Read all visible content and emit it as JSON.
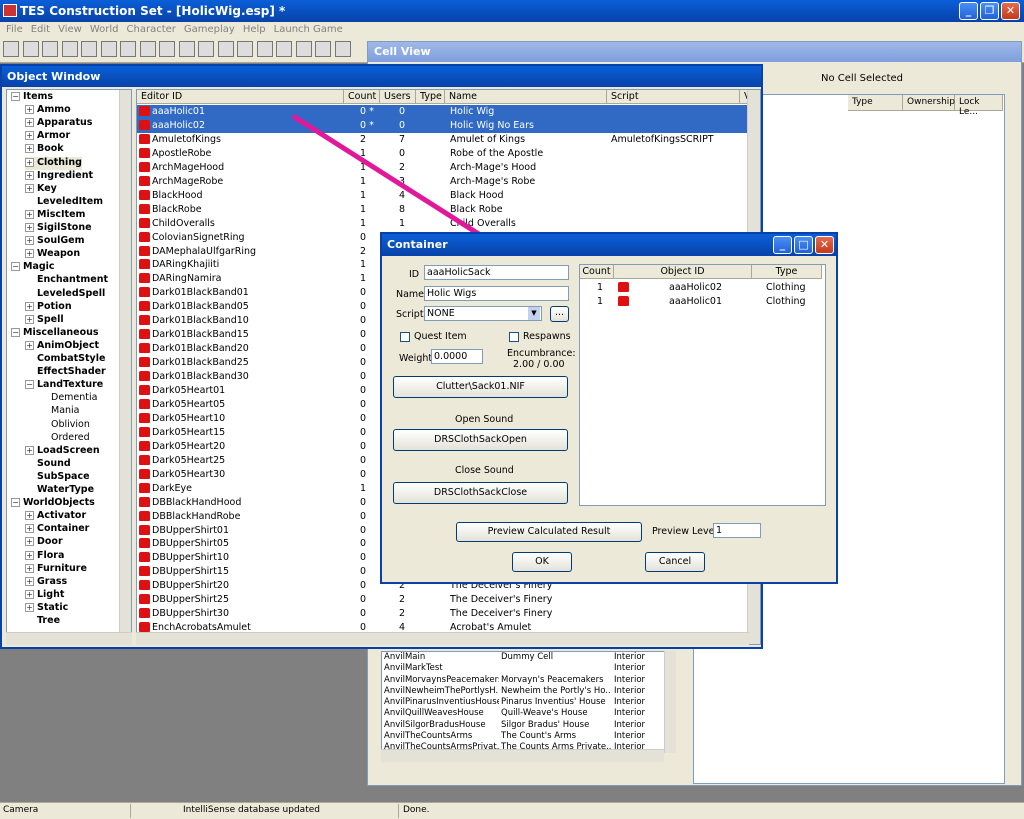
{
  "app": {
    "title": "TES Construction Set - [HolicWig.esp] *"
  },
  "menu": [
    "File",
    "Edit",
    "View",
    "World",
    "Character",
    "Gameplay",
    "Help",
    "Launch Game"
  ],
  "cell_view": {
    "title": "Cell View",
    "no_cell": "No Cell Selected",
    "columns": [
      "Type",
      "Ownership",
      "Lock Le..."
    ],
    "rows": [
      [
        "AnvilMain",
        "Dummy Cell",
        "Interior"
      ],
      [
        "AnvilMarkTest",
        "",
        "Interior"
      ],
      [
        "AnvilMorvaynsPeacemakers",
        "Morvayn's Peacemakers",
        "Interior"
      ],
      [
        "AnvilNewheimThePortlysH...",
        "Newheim the Portly's Ho...",
        "Interior"
      ],
      [
        "AnvilPinarusInventiusHouse",
        "Pinarus Inventius' House",
        "Interior"
      ],
      [
        "AnvilQuillWeavesHouse",
        "Quill-Weave's House",
        "Interior"
      ],
      [
        "AnvilSilgorBradusHouse",
        "Silgor Bradus' House",
        "Interior"
      ],
      [
        "AnvilTheCountsArms",
        "The Count's Arms",
        "Interior"
      ],
      [
        "AnvilTheCountsArmsPrivat...",
        "The Counts Arms Private...",
        "Interior"
      ]
    ]
  },
  "object_window": {
    "title": "Object Window",
    "tree": [
      {
        "label": "Items",
        "level": 0,
        "exp": "-"
      },
      {
        "label": "Ammo",
        "level": 1,
        "exp": "+"
      },
      {
        "label": "Apparatus",
        "level": 1,
        "exp": "+"
      },
      {
        "label": "Armor",
        "level": 1,
        "exp": "+"
      },
      {
        "label": "Book",
        "level": 1,
        "exp": "+"
      },
      {
        "label": "Clothing",
        "level": 1,
        "exp": "+",
        "sel": true
      },
      {
        "label": "Ingredient",
        "level": 1,
        "exp": "+"
      },
      {
        "label": "Key",
        "level": 1,
        "exp": "+"
      },
      {
        "label": "LeveledItem",
        "level": 1,
        "exp": ""
      },
      {
        "label": "MiscItem",
        "level": 1,
        "exp": "+"
      },
      {
        "label": "SigilStone",
        "level": 1,
        "exp": "+"
      },
      {
        "label": "SoulGem",
        "level": 1,
        "exp": "+"
      },
      {
        "label": "Weapon",
        "level": 1,
        "exp": "+"
      },
      {
        "label": "Magic",
        "level": 0,
        "exp": "-"
      },
      {
        "label": "Enchantment",
        "level": 1,
        "exp": ""
      },
      {
        "label": "LeveledSpell",
        "level": 1,
        "exp": ""
      },
      {
        "label": "Potion",
        "level": 1,
        "exp": "+"
      },
      {
        "label": "Spell",
        "level": 1,
        "exp": "+"
      },
      {
        "label": "Miscellaneous",
        "level": 0,
        "exp": "-"
      },
      {
        "label": "AnimObject",
        "level": 1,
        "exp": "+"
      },
      {
        "label": "CombatStyle",
        "level": 1,
        "exp": ""
      },
      {
        "label": "EffectShader",
        "level": 1,
        "exp": ""
      },
      {
        "label": "LandTexture",
        "level": 1,
        "exp": "-"
      },
      {
        "label": "Dementia",
        "level": 2,
        "exp": ""
      },
      {
        "label": "Mania",
        "level": 2,
        "exp": ""
      },
      {
        "label": "Oblivion",
        "level": 2,
        "exp": ""
      },
      {
        "label": "Ordered",
        "level": 2,
        "exp": ""
      },
      {
        "label": "LoadScreen",
        "level": 1,
        "exp": "+"
      },
      {
        "label": "Sound",
        "level": 1,
        "exp": ""
      },
      {
        "label": "SubSpace",
        "level": 1,
        "exp": ""
      },
      {
        "label": "WaterType",
        "level": 1,
        "exp": ""
      },
      {
        "label": "WorldObjects",
        "level": 0,
        "exp": "-"
      },
      {
        "label": "Activator",
        "level": 1,
        "exp": "+"
      },
      {
        "label": "Container",
        "level": 1,
        "exp": "+"
      },
      {
        "label": "Door",
        "level": 1,
        "exp": "+"
      },
      {
        "label": "Flora",
        "level": 1,
        "exp": "+"
      },
      {
        "label": "Furniture",
        "level": 1,
        "exp": "+"
      },
      {
        "label": "Grass",
        "level": 1,
        "exp": "+"
      },
      {
        "label": "Light",
        "level": 1,
        "exp": "+"
      },
      {
        "label": "Static",
        "level": 1,
        "exp": "+"
      },
      {
        "label": "Tree",
        "level": 1,
        "exp": ""
      }
    ],
    "columns": [
      "Editor ID",
      "Count",
      "Users",
      "Type",
      "Name",
      "Script",
      "V"
    ],
    "rows": [
      {
        "id": "aaaHolic01",
        "count": "0 *",
        "users": "0",
        "name": "Holic Wig",
        "script": "",
        "sel": true
      },
      {
        "id": "aaaHolic02",
        "count": "0 *",
        "users": "0",
        "name": "Holic Wig No Ears",
        "script": "",
        "sel": true
      },
      {
        "id": "AmuletofKings",
        "count": "2",
        "users": "7",
        "name": "Amulet of Kings",
        "script": "AmuletofKingsSCRIPT"
      },
      {
        "id": "ApostleRobe",
        "count": "1",
        "users": "0",
        "name": "Robe of the Apostle",
        "script": ""
      },
      {
        "id": "ArchMageHood",
        "count": "1",
        "users": "2",
        "name": "Arch-Mage's Hood",
        "script": ""
      },
      {
        "id": "ArchMageRobe",
        "count": "1",
        "users": "3",
        "name": "Arch-Mage's Robe",
        "script": ""
      },
      {
        "id": "BlackHood",
        "count": "1",
        "users": "4",
        "name": "Black Hood",
        "script": ""
      },
      {
        "id": "BlackRobe",
        "count": "1",
        "users": "8",
        "name": "Black Robe",
        "script": ""
      },
      {
        "id": "ChildOveralls",
        "count": "1",
        "users": "1",
        "name": "Child Overalls",
        "script": ""
      },
      {
        "id": "ColovianSignetRing",
        "count": "0",
        "users": "",
        "name": "",
        "script": ""
      },
      {
        "id": "DAMephalaUlfgarRing",
        "count": "2",
        "users": "",
        "name": "",
        "script": ""
      },
      {
        "id": "DARingKhajiiti",
        "count": "1",
        "users": "",
        "name": "",
        "script": ""
      },
      {
        "id": "DARingNamira",
        "count": "1",
        "users": "",
        "name": "",
        "script": ""
      },
      {
        "id": "Dark01BlackBand01",
        "count": "0",
        "users": "",
        "name": "",
        "script": ""
      },
      {
        "id": "Dark01BlackBand05",
        "count": "0",
        "users": "",
        "name": "",
        "script": ""
      },
      {
        "id": "Dark01BlackBand10",
        "count": "0",
        "users": "",
        "name": "",
        "script": ""
      },
      {
        "id": "Dark01BlackBand15",
        "count": "0",
        "users": "",
        "name": "",
        "script": ""
      },
      {
        "id": "Dark01BlackBand20",
        "count": "0",
        "users": "",
        "name": "",
        "script": ""
      },
      {
        "id": "Dark01BlackBand25",
        "count": "0",
        "users": "",
        "name": "",
        "script": ""
      },
      {
        "id": "Dark01BlackBand30",
        "count": "0",
        "users": "",
        "name": "",
        "script": ""
      },
      {
        "id": "Dark05Heart01",
        "count": "0",
        "users": "",
        "name": "",
        "script": ""
      },
      {
        "id": "Dark05Heart05",
        "count": "0",
        "users": "",
        "name": "",
        "script": ""
      },
      {
        "id": "Dark05Heart10",
        "count": "0",
        "users": "",
        "name": "",
        "script": ""
      },
      {
        "id": "Dark05Heart15",
        "count": "0",
        "users": "",
        "name": "",
        "script": ""
      },
      {
        "id": "Dark05Heart20",
        "count": "0",
        "users": "",
        "name": "",
        "script": ""
      },
      {
        "id": "Dark05Heart25",
        "count": "0",
        "users": "",
        "name": "",
        "script": ""
      },
      {
        "id": "Dark05Heart30",
        "count": "0",
        "users": "",
        "name": "",
        "script": ""
      },
      {
        "id": "DarkEye",
        "count": "1",
        "users": "",
        "name": "",
        "script": ""
      },
      {
        "id": "DBBlackHandHood",
        "count": "0",
        "users": "",
        "name": "",
        "script": ""
      },
      {
        "id": "DBBlackHandRobe",
        "count": "0",
        "users": "",
        "name": "",
        "script": ""
      },
      {
        "id": "DBUpperShirt01",
        "count": "0",
        "users": "",
        "name": "",
        "script": ""
      },
      {
        "id": "DBUpperShirt05",
        "count": "0",
        "users": "",
        "name": "",
        "script": ""
      },
      {
        "id": "DBUpperShirt10",
        "count": "0",
        "users": "",
        "name": "",
        "script": ""
      },
      {
        "id": "DBUpperShirt15",
        "count": "0",
        "users": "",
        "name": "",
        "script": ""
      },
      {
        "id": "DBUpperShirt20",
        "count": "0",
        "users": "2",
        "name": "The Deceiver's Finery",
        "script": ""
      },
      {
        "id": "DBUpperShirt25",
        "count": "0",
        "users": "2",
        "name": "The Deceiver's Finery",
        "script": ""
      },
      {
        "id": "DBUpperShirt30",
        "count": "0",
        "users": "2",
        "name": "The Deceiver's Finery",
        "script": ""
      },
      {
        "id": "EnchAcrobatsAmulet",
        "count": "0",
        "users": "4",
        "name": "Acrobat's Amulet",
        "script": ""
      }
    ]
  },
  "container": {
    "title": "Container",
    "id_label": "ID",
    "id_value": "aaaHolicSack",
    "name_label": "Name",
    "name_value": "Holic Wigs",
    "script_label": "Script",
    "script_value": "NONE",
    "browse_label": "...",
    "quest_item": "Quest Item",
    "respawns": "Respawns",
    "weight_label": "Weight",
    "weight_value": "0.0000",
    "encumbrance_label": "Encumbrance:",
    "encumbrance_value": "2.00 / 0.00",
    "model_button": "Clutter\\Sack01.NIF",
    "open_sound_label": "Open Sound",
    "open_sound_button": "DRSClothSackOpen",
    "close_sound_label": "Close Sound",
    "close_sound_button": "DRSClothSackClose",
    "preview_button": "Preview Calculated Result",
    "preview_level_label": "Preview Level",
    "preview_level_value": "1",
    "ok": "OK",
    "cancel": "Cancel",
    "columns": [
      "Count",
      "Object ID",
      "Type"
    ],
    "items": [
      {
        "count": "1",
        "object_id": "aaaHolic02",
        "type": "Clothing"
      },
      {
        "count": "1",
        "object_id": "aaaHolic01",
        "type": "Clothing"
      }
    ]
  },
  "status": {
    "left": "Camera",
    "middle": "IntelliSense database updated",
    "right": "Done."
  },
  "colors": {
    "arrow": "#e2189a",
    "selection": "#316ac5",
    "titlebar": "#0a5fd8"
  }
}
